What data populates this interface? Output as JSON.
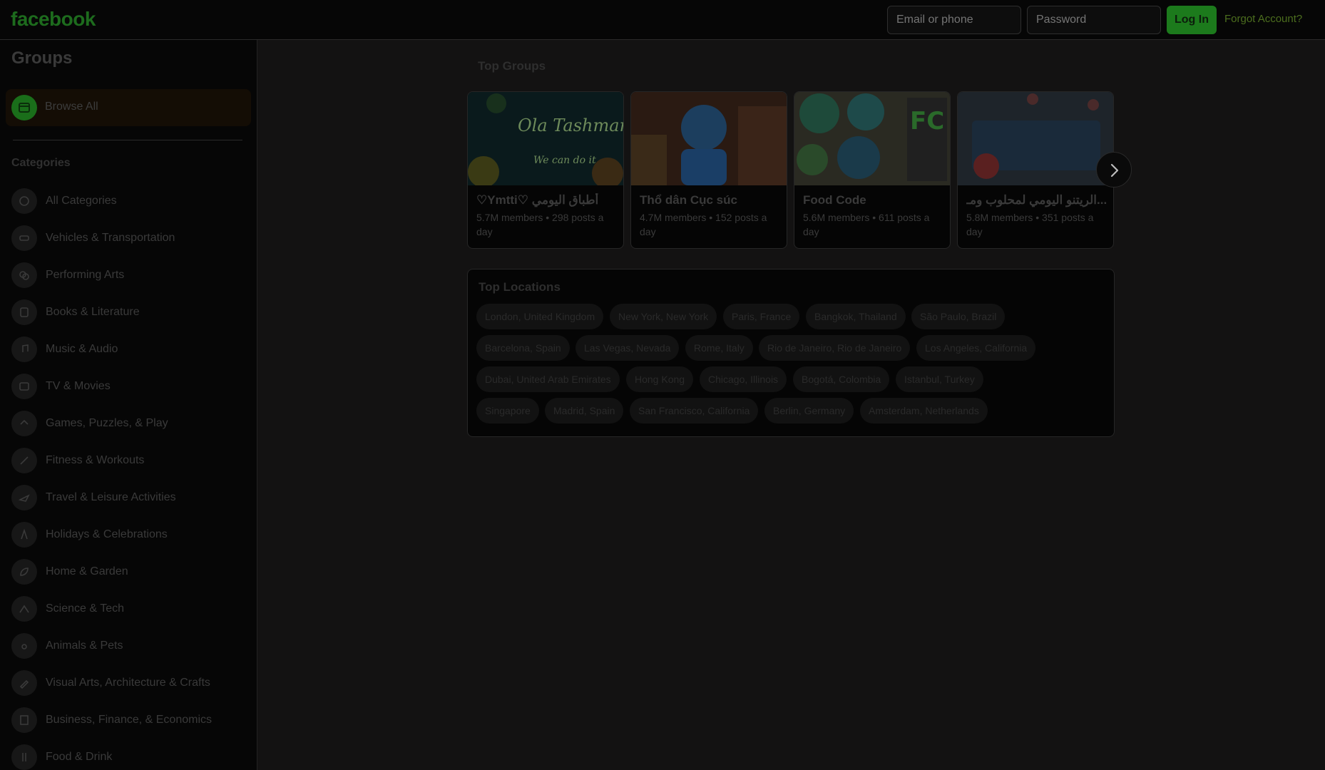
{
  "header": {
    "logo": "facebook",
    "email_placeholder": "Email or phone",
    "password_placeholder": "Password",
    "login_label": "Log In",
    "forgot_label": "Forgot Account?"
  },
  "sidebar": {
    "title": "Groups",
    "browse_all": "Browse All",
    "categories_heading": "Categories",
    "categories": [
      {
        "label": "All Categories",
        "icon": "grid-icon"
      },
      {
        "label": "Vehicles & Transportation",
        "icon": "car-icon"
      },
      {
        "label": "Performing Arts",
        "icon": "theater-masks-icon"
      },
      {
        "label": "Books & Literature",
        "icon": "book-icon"
      },
      {
        "label": "Music & Audio",
        "icon": "music-note-icon"
      },
      {
        "label": "TV & Movies",
        "icon": "film-icon"
      },
      {
        "label": "Games, Puzzles, & Play",
        "icon": "game-controller-icon"
      },
      {
        "label": "Fitness & Workouts",
        "icon": "dumbbell-icon"
      },
      {
        "label": "Travel & Leisure Activities",
        "icon": "airplane-icon"
      },
      {
        "label": "Holidays & Celebrations",
        "icon": "party-icon"
      },
      {
        "label": "Home & Garden",
        "icon": "leaf-icon"
      },
      {
        "label": "Science & Tech",
        "icon": "flask-icon"
      },
      {
        "label": "Animals & Pets",
        "icon": "paw-icon"
      },
      {
        "label": "Visual Arts, Architecture & Crafts",
        "icon": "brush-icon"
      },
      {
        "label": "Business, Finance, & Economics",
        "icon": "building-icon"
      },
      {
        "label": "Food & Drink",
        "icon": "fork-knife-icon"
      }
    ]
  },
  "main": {
    "top_groups_title": "Top Groups",
    "groups": [
      {
        "name": "♡Ymtti♡ أطباق اليومي",
        "meta": "5.7M members • 298 posts a day",
        "image_text": "Ola Tashman"
      },
      {
        "name": "Thổ dân Cục súc",
        "meta": "4.7M members • 152 posts a day",
        "image_text": ""
      },
      {
        "name": "Food Code",
        "meta": "5.6M members • 611 posts a day",
        "image_text": "FC"
      },
      {
        "name": "الريتنو اليومي لمحلوب ومـ...",
        "meta": "5.8M members • 351 posts a day",
        "image_text": ""
      }
    ],
    "next_icon": "chevron-right-icon",
    "top_locations_title": "Top Locations",
    "locations": [
      "London, United Kingdom",
      "New York, New York",
      "Paris, France",
      "Bangkok, Thailand",
      "São Paulo, Brazil",
      "Barcelona, Spain",
      "Las Vegas, Nevada",
      "Rome, Italy",
      "Rio de Janeiro, Rio de Janeiro",
      "Los Angeles, California",
      "Dubai, United Arab Emirates",
      "Hong Kong",
      "Chicago, Illinois",
      "Bogotá, Colombia",
      "Istanbul, Turkey",
      "Singapore",
      "Madrid, Spain",
      "San Francisco, California",
      "Berlin, Germany",
      "Amsterdam, Netherlands"
    ]
  },
  "colors": {
    "brand": "#1d6b1d",
    "background": "#131212",
    "panel": "#060606"
  }
}
